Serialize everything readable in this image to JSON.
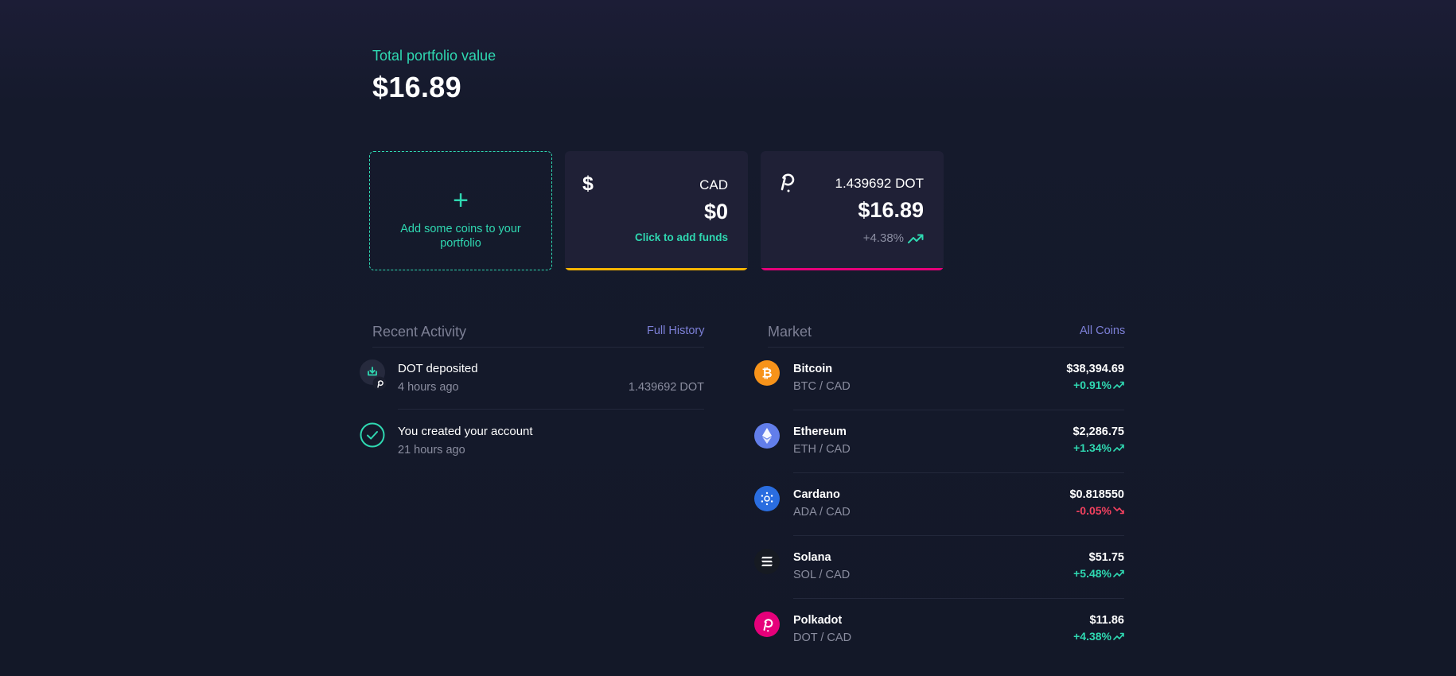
{
  "portfolio": {
    "label": "Total portfolio value",
    "value": "$16.89"
  },
  "cards": {
    "add": {
      "plus": "+",
      "text": "Add some coins to your portfolio"
    },
    "cad": {
      "symbol": "$",
      "currency": "CAD",
      "amount": "$0",
      "cta": "Click to add funds",
      "accent": "#f5b400"
    },
    "dot": {
      "quantity": "1.439692 DOT",
      "amount": "$16.89",
      "change": "+4.38%",
      "icon": "polkadot-icon",
      "accent": "#e6007a"
    }
  },
  "activity": {
    "title": "Recent Activity",
    "link": "Full History",
    "items": [
      {
        "title": "DOT deposited",
        "time": "4 hours ago",
        "amount": "1.439692 DOT",
        "icon": "deposit-icon"
      },
      {
        "title": "You created your account",
        "time": "21 hours ago",
        "amount": "",
        "icon": "check-circle-icon"
      }
    ]
  },
  "market": {
    "title": "Market",
    "link": "All Coins",
    "coins": [
      {
        "name": "Bitcoin",
        "pair": "BTC / CAD",
        "price": "$38,394.69",
        "change": "+0.91%",
        "direction": "up",
        "color": "#f7931a",
        "icon": "bitcoin-icon"
      },
      {
        "name": "Ethereum",
        "pair": "ETH / CAD",
        "price": "$2,286.75",
        "change": "+1.34%",
        "direction": "up",
        "color": "#627eea",
        "icon": "ethereum-icon"
      },
      {
        "name": "Cardano",
        "pair": "ADA / CAD",
        "price": "$0.818550",
        "change": "-0.05%",
        "direction": "down",
        "color": "#2a6de0",
        "icon": "cardano-icon"
      },
      {
        "name": "Solana",
        "pair": "SOL / CAD",
        "price": "$51.75",
        "change": "+5.48%",
        "direction": "up",
        "color": "#161a22",
        "icon": "solana-icon"
      },
      {
        "name": "Polkadot",
        "pair": "DOT / CAD",
        "price": "$11.86",
        "change": "+4.38%",
        "direction": "up",
        "color": "#e6007a",
        "icon": "polkadot-icon"
      }
    ]
  },
  "colors": {
    "accent": "#2fd8b1",
    "link": "#7d80d8",
    "negative": "#f2415f",
    "card": "#1f2036"
  }
}
